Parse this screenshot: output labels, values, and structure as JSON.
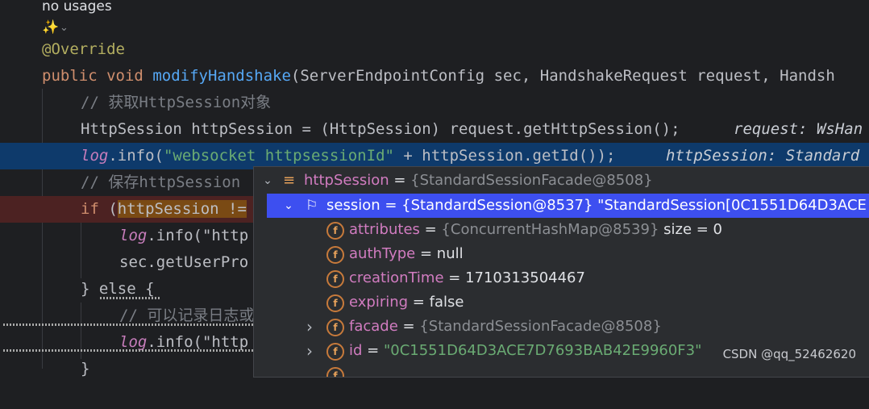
{
  "editor": {
    "usage_hint": "no usages",
    "ai_icon": "✨",
    "ai_chevron": "⌄",
    "annotation": "@Override",
    "signature": {
      "kw1": "public",
      "kw2": "void",
      "method": "modifyHandshake",
      "params": "(ServerEndpointConfig sec, HandshakeRequest request, Handsh"
    },
    "comment1": "// 获取HttpSession对象",
    "line_session": "HttpSession httpSession = (HttpSession) request.getHttpSession();",
    "hint_request": "request: WsHan",
    "line_log_field": "log",
    "line_log_call": ".info(",
    "line_log_str": "\"websocket httpsessionId\"",
    "line_log_rest": " + httpSession.getId());",
    "hint_session": "httpSession: Standard",
    "comment2": "// 保存httpSession",
    "if_kw": "if",
    "if_rest": " (",
    "if_highlight": "httpSession !=",
    "log2_field": "log",
    "log2_rest": ".info(\"http",
    "sec_line": "sec.getUserPro",
    "else_line": "} else {",
    "comment3": "// 可以记录日志或",
    "log3_field": "log",
    "log3_rest": ".info(\"http",
    "close_brace": "}"
  },
  "popup": {
    "rows": [
      {
        "chevron": "⌄",
        "icon": "≡",
        "name": "httpSession",
        "eq": " = ",
        "gray": "{StandardSessionFacade@8508}",
        "value": ""
      },
      {
        "chevron": "⌄",
        "icon": "⚐",
        "name": "session",
        "eq": " = ",
        "gray": "",
        "value": "{StandardSession@8537} \"StandardSession[0C1551D64D3ACE"
      },
      {
        "chevron": "",
        "icon": "f",
        "name": "attributes",
        "eq": " = ",
        "gray": "{ConcurrentHashMap@8539}",
        "value": " size = 0"
      },
      {
        "chevron": "",
        "icon": "f",
        "name": "authType",
        "eq": " = ",
        "gray": "",
        "value": "null"
      },
      {
        "chevron": "",
        "icon": "f",
        "name": "creationTime",
        "eq": " = ",
        "gray": "",
        "value": "1710313504467"
      },
      {
        "chevron": "",
        "icon": "f",
        "name": "expiring",
        "eq": " = ",
        "gray": "",
        "value": "false"
      },
      {
        "chevron": "›",
        "icon": "f",
        "name": "facade",
        "eq": " = ",
        "gray": "{StandardSessionFacade@8508}",
        "value": ""
      },
      {
        "chevron": "›",
        "icon": "f",
        "name": "id",
        "eq": " = ",
        "gray": "",
        "value": "",
        "str": "\"0C1551D64D3ACE7D7693BAB42E9960F3\""
      }
    ]
  },
  "watermark": "CSDN @qq_52462620"
}
